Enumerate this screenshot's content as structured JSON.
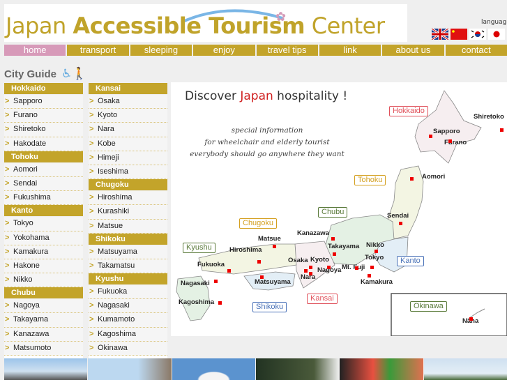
{
  "header": {
    "logo_part1": "Japan ",
    "logo_part2": "Accessible Tourism",
    "logo_part3": " Center",
    "language_label": "language",
    "flags": [
      {
        "name": "english-flag-icon"
      },
      {
        "name": "chinese-flag-icon"
      },
      {
        "name": "korean-flag-icon"
      },
      {
        "name": "japanese-flag-icon"
      }
    ]
  },
  "nav": [
    "home",
    "transport",
    "sleeping",
    "enjoy",
    "travel tips",
    "link",
    "about us",
    "contact"
  ],
  "city_guide": {
    "title": "City Guide",
    "left": [
      {
        "region": "Hokkaido",
        "cities": [
          "Sapporo",
          "Furano",
          "Shiretoko",
          "Hakodate"
        ]
      },
      {
        "region": "Tohoku",
        "cities": [
          "Aomori",
          "Sendai",
          "Fukushima"
        ]
      },
      {
        "region": "Kanto",
        "cities": [
          "Tokyo",
          "Yokohama",
          "Kamakura",
          "Hakone",
          "Nikko"
        ]
      },
      {
        "region": "Chubu",
        "cities": [
          "Nagoya",
          "Takayama",
          "Kanazawa",
          "Matsumoto"
        ]
      }
    ],
    "right": [
      {
        "region": "Kansai",
        "cities": [
          "Osaka",
          "Kyoto",
          "Nara",
          "Kobe",
          "Himeji",
          "Iseshima"
        ]
      },
      {
        "region": "Chugoku",
        "cities": [
          "Hiroshima",
          "Kurashiki",
          "Matsue"
        ]
      },
      {
        "region": "Shikoku",
        "cities": [
          "Matsuyama",
          "Takamatsu"
        ]
      },
      {
        "region": "Kyushu",
        "cities": [
          "Fukuoka",
          "Nagasaki",
          "Kumamoto",
          "Kagoshima",
          "Okinawa"
        ]
      }
    ]
  },
  "map": {
    "title_part1": "Discover ",
    "title_part2": "Japan",
    "title_part3": " hospitality !",
    "subtitle": [
      "special information",
      "for wheelchair and elderly tourist",
      "everybody should go anywhere they want"
    ],
    "regions": {
      "hokkaido": "Hokkaido",
      "tohoku": "Tohoku",
      "chubu": "Chubu",
      "chugoku": "Chugoku",
      "kyushu": "Kyushu",
      "kanto": "Kanto",
      "kansai": "Kansai",
      "shikoku": "Shikoku",
      "okinawa": "Okinawa"
    },
    "cities": {
      "shiretoko": "Shiretoko",
      "sapporo": "Sapporo",
      "furano": "Furano",
      "aomori": "Aomori",
      "sendai": "Sendai",
      "kanazawa": "Kanazawa",
      "matsue": "Matsue",
      "hiroshima": "Hiroshima",
      "takayama": "Takayama",
      "nikko": "Nikko",
      "tokyo": "Tokyo",
      "osaka": "Osaka",
      "kyoto": "Kyoto",
      "mtfuji": "Mt. Fuji",
      "fukuoka": "Fukuoka",
      "nagoya": "Nagoya",
      "nara": "Nara",
      "nagasaki": "Nagasaki",
      "matsuyama": "Matsuyama",
      "kamakura": "Kamakura",
      "kagoshima": "Kagoshima",
      "naha": "Naha"
    },
    "colors": {
      "hokkaido": "#e0505a",
      "tohoku": "#d4a020",
      "chubu": "#5a7a3a",
      "chugoku": "#d4a020",
      "kyushu": "#5a7a3a",
      "kanto": "#4a72b8",
      "kansai": "#e0505a",
      "shikoku": "#4a72b8",
      "okinawa": "#5a7a3a"
    }
  },
  "colors": {
    "brand_gold": "#c3a42a",
    "active_pink": "#d79ab9"
  }
}
